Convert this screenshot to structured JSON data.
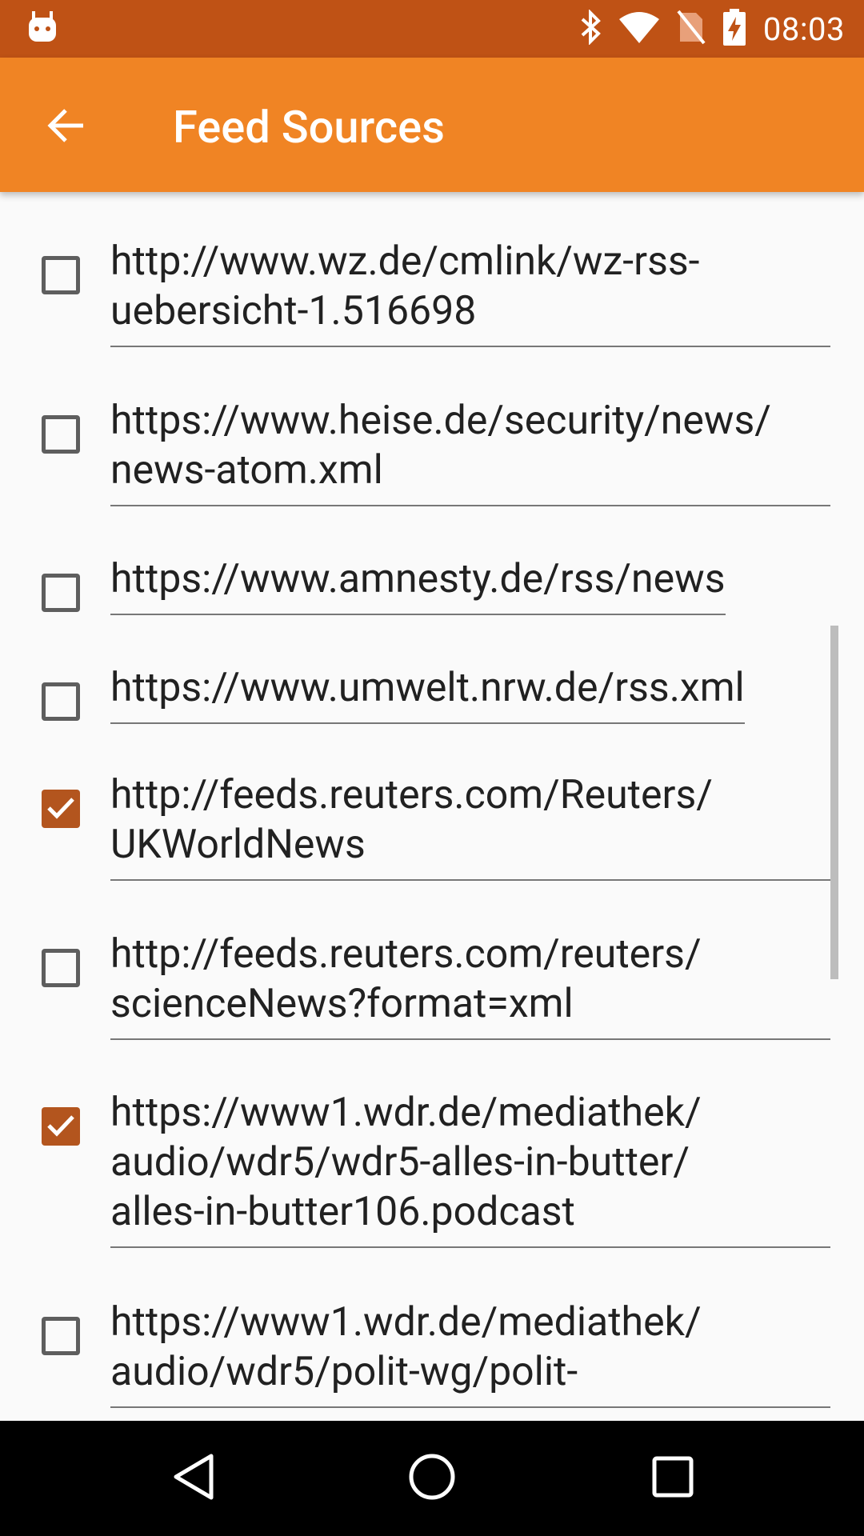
{
  "status_bar": {
    "time": "08:03",
    "icons": [
      "android-robot-icon",
      "bluetooth-icon",
      "wifi-icon",
      "no-sim-icon",
      "battery-charging-icon"
    ],
    "color": "#BF5215"
  },
  "app_bar": {
    "title": "Feed Sources",
    "back_icon": "arrow-back-icon",
    "color": "#F08424"
  },
  "feeds": [
    {
      "url": "http://www.wz.de/cmlink/wz-rss-\nuebersicht-1.516698",
      "checked": false
    },
    {
      "url": "https://www.heise.de/security/news/\nnews-atom.xml",
      "checked": false
    },
    {
      "url": "https://www.amnesty.de/rss/news",
      "checked": false
    },
    {
      "url": "https://www.umwelt.nrw.de/rss.xml",
      "checked": false
    },
    {
      "url": "http://feeds.reuters.com/Reuters/\nUKWorldNews",
      "checked": true
    },
    {
      "url": "http://feeds.reuters.com/reuters/\nscienceNews?format=xml",
      "checked": false
    },
    {
      "url": "https://www1.wdr.de/mediathek/\naudio/wdr5/wdr5-alles-in-butter/\nalles-in-butter106.podcast",
      "checked": true
    },
    {
      "url": "https://www1.wdr.de/mediathek/\naudio/wdr5/polit-wg/polit-",
      "checked": false
    }
  ],
  "nav_bar": {
    "icons": [
      "back-triangle-icon",
      "home-circle-icon",
      "recents-square-icon"
    ]
  },
  "accent_color": "#B3551E"
}
